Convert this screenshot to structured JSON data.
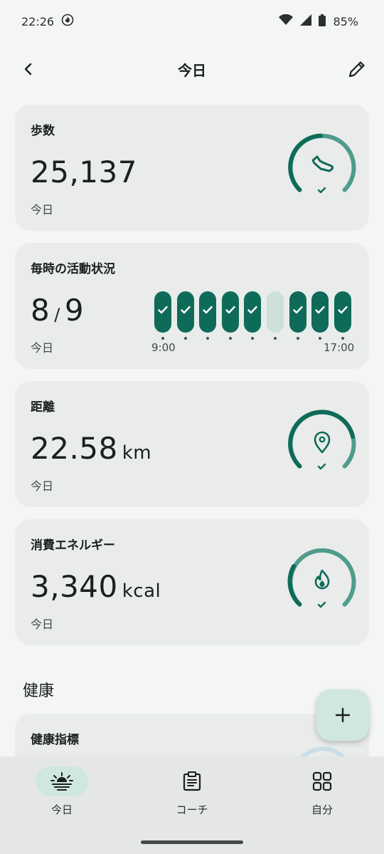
{
  "status_bar": {
    "time": "22:26",
    "battery": "85%"
  },
  "header": {
    "title": "今日"
  },
  "cards": {
    "steps": {
      "title": "歩数",
      "value": "25,137",
      "sub": "今日",
      "ring_progress": 0.92
    },
    "hourly": {
      "title": "毎時の活動状況",
      "value": "8",
      "total": "9",
      "separator": "/",
      "sub": "今日",
      "start_label": "9:00",
      "end_label": "17:00",
      "hours": [
        true,
        true,
        true,
        true,
        true,
        false,
        true,
        true,
        true
      ]
    },
    "distance": {
      "title": "距離",
      "value": "22.58",
      "unit": "km",
      "sub": "今日",
      "ring_progress": 0.85
    },
    "energy": {
      "title": "消費エネルギー",
      "value": "3,340",
      "unit": "kcal",
      "sub": "今日",
      "ring_progress": 0.7
    }
  },
  "health": {
    "heading": "健康",
    "card_title": "健康指標"
  },
  "nav": {
    "items": [
      {
        "label": "今日",
        "icon": "sunrise-icon",
        "active": true
      },
      {
        "label": "コーチ",
        "icon": "clipboard-icon",
        "active": false
      },
      {
        "label": "自分",
        "icon": "grid-icon",
        "active": false
      }
    ]
  },
  "colors": {
    "accent": "#0f6b59",
    "accent_light": "#4f9b8c",
    "track": "#cddfd9",
    "card_bg": "#e9ecea"
  }
}
